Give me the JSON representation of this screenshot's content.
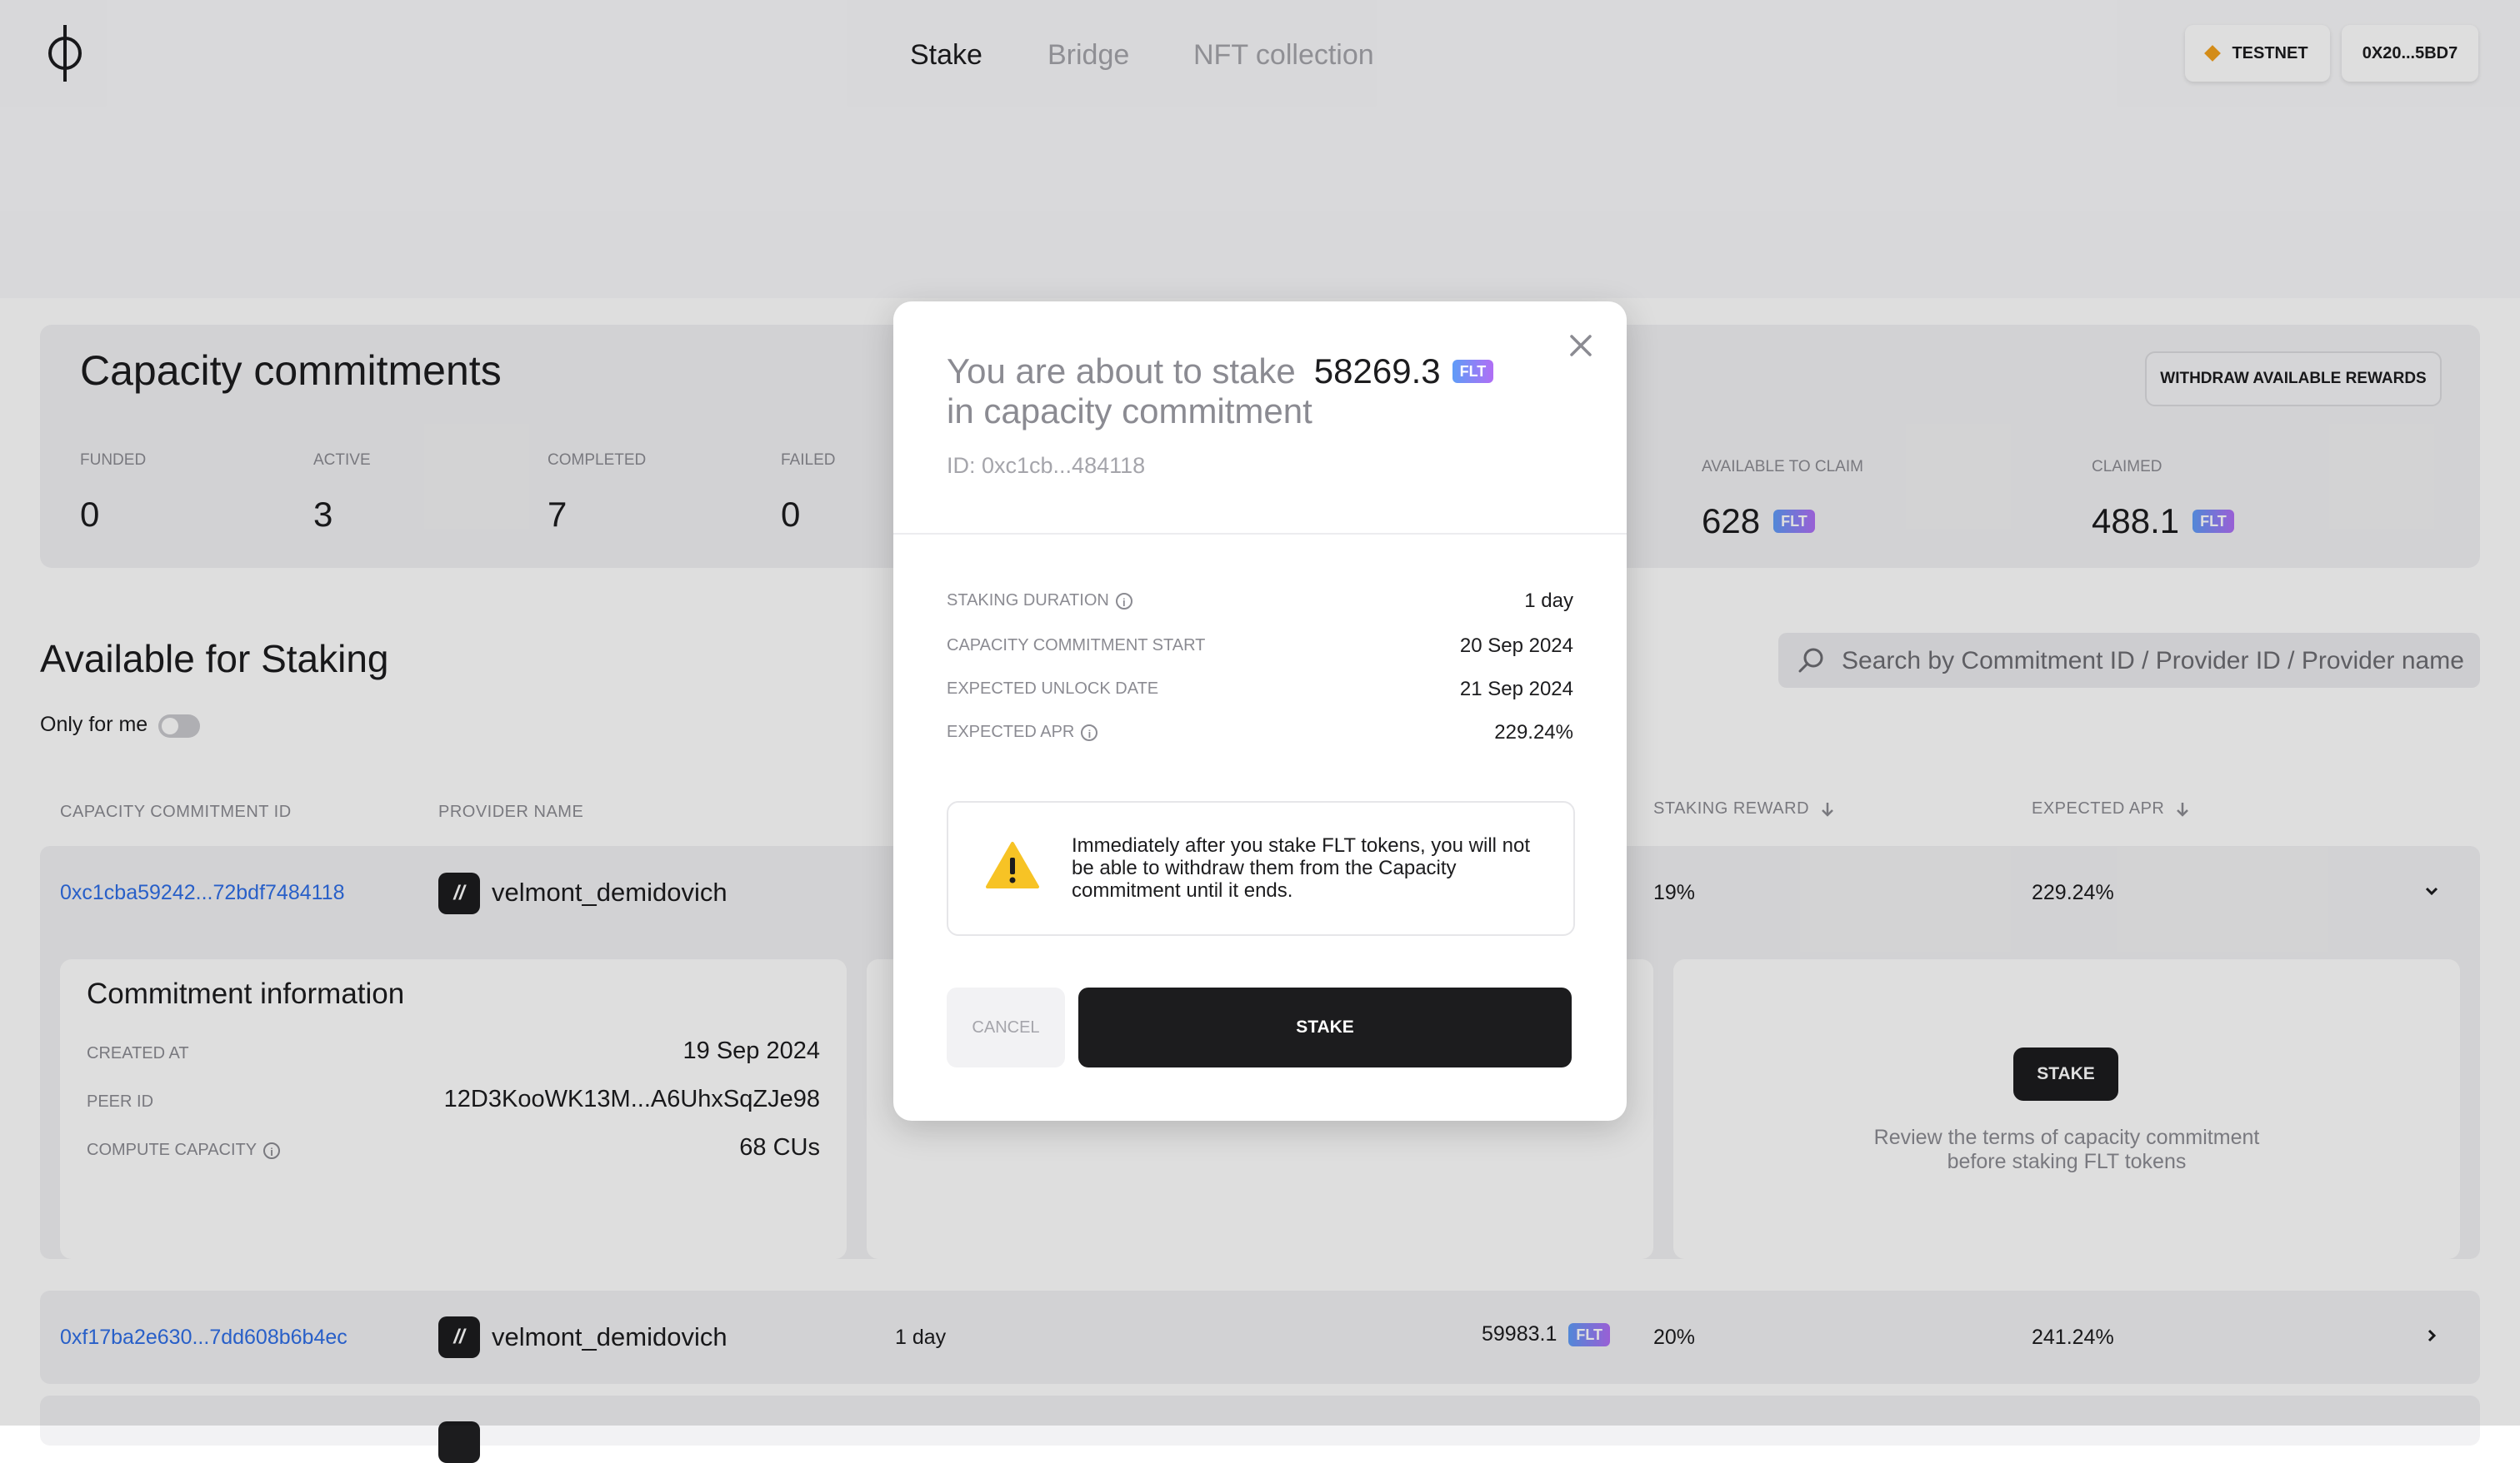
{
  "header": {
    "nav": [
      "Stake",
      "Bridge",
      "NFT collection"
    ],
    "network_label": "TESTNET",
    "wallet_address": "0X20...5BD7"
  },
  "stats": {
    "title": "Capacity commitments",
    "withdraw_button": "WITHDRAW AVAILABLE REWARDS",
    "items": [
      {
        "label": "FUNDED",
        "value": "0"
      },
      {
        "label": "ACTIVE",
        "value": "3"
      },
      {
        "label": "COMPLETED",
        "value": "7"
      },
      {
        "label": "FAILED",
        "value": "0"
      }
    ],
    "rewards": [
      {
        "label": "AVAILABLE TO CLAIM",
        "value": "628",
        "token": "FLT"
      },
      {
        "label": "CLAIMED",
        "value": "488.1",
        "token": "FLT"
      }
    ]
  },
  "staking": {
    "title": "Available for Staking",
    "only_for_me_label": "Only for me",
    "search_placeholder": "Search by Commitment ID / Provider ID / Provider name",
    "columns": {
      "id": "CAPACITY COMMITMENT ID",
      "provider": "PROVIDER NAME",
      "reward": "STAKING REWARD",
      "apr": "EXPECTED APR"
    },
    "rows": [
      {
        "id": "0xc1cba59242...72bdf7484118",
        "provider": "velmont_demidovich",
        "reward": "19%",
        "apr": "229.24%"
      },
      {
        "id": "0xf17ba2e630...7dd608b6b4ec",
        "provider": "velmont_demidovich",
        "duration": "1 day",
        "amount": "59983.1",
        "token": "FLT",
        "reward": "20%",
        "apr": "241.24%"
      }
    ],
    "commitment_info": {
      "title": "Commitment information",
      "created_at_label": "CREATED AT",
      "created_at": "19 Sep 2024",
      "peer_id_label": "PEER ID",
      "peer_id": "12D3KooWK13M...A6UhxSqZJe98",
      "compute_label": "COMPUTE CAPACITY",
      "compute_value": "68 CUs"
    },
    "stake_card": {
      "button": "STAKE",
      "note": "Review the terms of capacity commitment before staking FLT tokens"
    }
  },
  "modal": {
    "title_prefix": "You are about to stake",
    "amount": "58269.3",
    "token": "FLT",
    "title_suffix": "in capacity commitment",
    "id_text": "ID: 0xc1cb...484118",
    "rows": [
      {
        "label": "STAKING DURATION",
        "value": "1 day",
        "info": true
      },
      {
        "label": "CAPACITY COMMITMENT START",
        "value": "20 Sep 2024",
        "info": false
      },
      {
        "label": "EXPECTED UNLOCK DATE",
        "value": "21 Sep 2024",
        "info": false
      },
      {
        "label": "EXPECTED APR",
        "value": "229.24%",
        "info": true
      }
    ],
    "warning": "Immediately after you stake FLT tokens, you will not be able to withdraw them from the Capacity commitment until it ends.",
    "cancel_label": "CANCEL",
    "stake_label": "STAKE"
  }
}
